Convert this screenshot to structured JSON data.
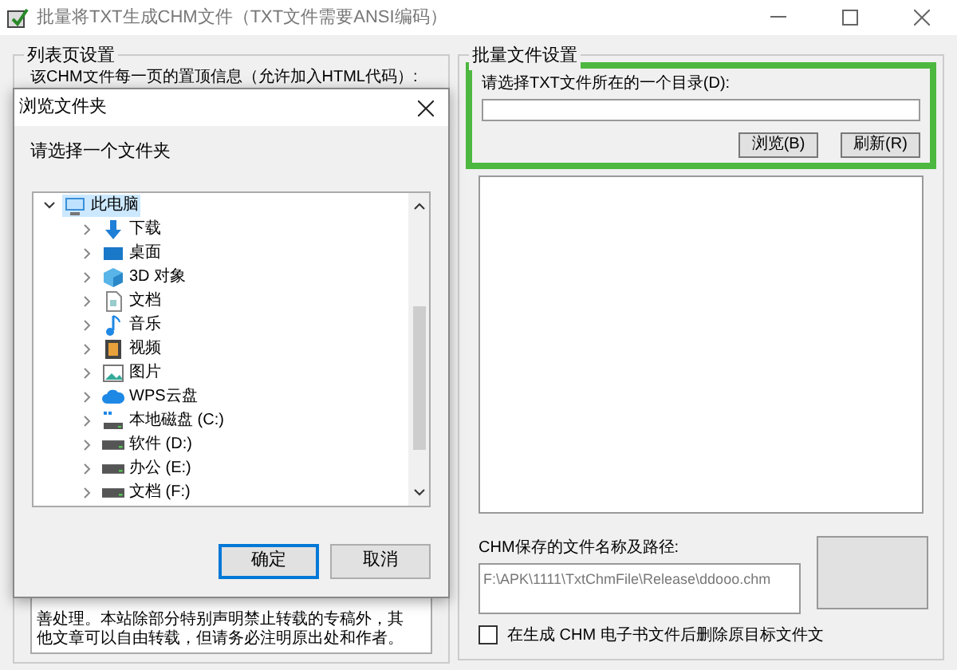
{
  "window": {
    "title": "批量将TXT生成CHM文件（TXT文件需要ANSI编码）"
  },
  "left_group": {
    "title": "列表页设置",
    "label": "该CHM文件每一页的置顶信息（允许加入HTML代码）:",
    "text_visible": "善处理。本站除部分特别声明禁止转载的专稿外，其他文章可以自由转载，但请务必注明原出处和作者。"
  },
  "right_group": {
    "title": "批量文件设置",
    "dir_label": "请选择TXT文件所在的一个目录(D):",
    "browse_button": "浏览(B)",
    "refresh_button": "刷新(R)",
    "path_label": "CHM保存的文件名称及路径:",
    "path_value": "F:\\APK\\1111\\TxtChmFile\\Release\\ddooo.chm",
    "delete_option": {
      "label": "在生成 CHM 电子书文件后删除原目标文件文",
      "checked": false
    }
  },
  "dialog": {
    "title": "浏览文件夹",
    "prompt": "请选择一个文件夹",
    "tree": [
      {
        "label": "此电脑",
        "kind": "pc",
        "selected": true,
        "expanded": true,
        "children": [
          {
            "label": "下载",
            "kind": "download",
            "selected": false,
            "expanded": false
          },
          {
            "label": "桌面",
            "kind": "desktop",
            "selected": false,
            "expanded": false
          },
          {
            "label": "3D 对象",
            "kind": "cube",
            "selected": false,
            "expanded": false
          },
          {
            "label": "文档",
            "kind": "doc",
            "selected": false,
            "expanded": false
          },
          {
            "label": "音乐",
            "kind": "music",
            "selected": false,
            "expanded": false
          },
          {
            "label": "视频",
            "kind": "video",
            "selected": false,
            "expanded": false
          },
          {
            "label": "图片",
            "kind": "image",
            "selected": false,
            "expanded": false
          },
          {
            "label": "WPS云盘",
            "kind": "cloud",
            "selected": false,
            "expanded": false
          },
          {
            "label": "本地磁盘 (C:)",
            "kind": "sysdrive",
            "selected": false,
            "expanded": false
          },
          {
            "label": "软件 (D:)",
            "kind": "drive",
            "selected": false,
            "expanded": false
          },
          {
            "label": "办公 (E:)",
            "kind": "drive",
            "selected": false,
            "expanded": false
          },
          {
            "label": "文档 (F:)",
            "kind": "drive",
            "selected": false,
            "expanded": false
          }
        ]
      }
    ],
    "ok_button": "确定",
    "cancel_button": "取消"
  }
}
